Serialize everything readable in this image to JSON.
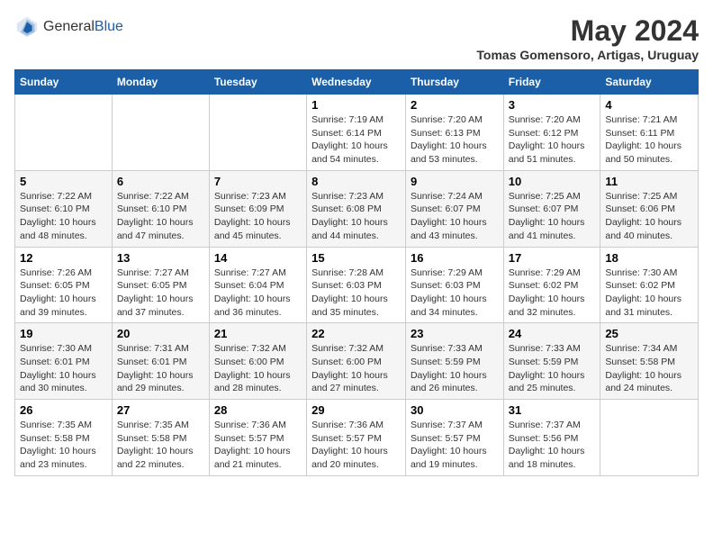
{
  "header": {
    "logo_general": "General",
    "logo_blue": "Blue",
    "month_year": "May 2024",
    "location": "Tomas Gomensoro, Artigas, Uruguay"
  },
  "weekdays": [
    "Sunday",
    "Monday",
    "Tuesday",
    "Wednesday",
    "Thursday",
    "Friday",
    "Saturday"
  ],
  "weeks": [
    [
      {
        "day": "",
        "info": ""
      },
      {
        "day": "",
        "info": ""
      },
      {
        "day": "",
        "info": ""
      },
      {
        "day": "1",
        "info": "Sunrise: 7:19 AM\nSunset: 6:14 PM\nDaylight: 10 hours\nand 54 minutes."
      },
      {
        "day": "2",
        "info": "Sunrise: 7:20 AM\nSunset: 6:13 PM\nDaylight: 10 hours\nand 53 minutes."
      },
      {
        "day": "3",
        "info": "Sunrise: 7:20 AM\nSunset: 6:12 PM\nDaylight: 10 hours\nand 51 minutes."
      },
      {
        "day": "4",
        "info": "Sunrise: 7:21 AM\nSunset: 6:11 PM\nDaylight: 10 hours\nand 50 minutes."
      }
    ],
    [
      {
        "day": "5",
        "info": "Sunrise: 7:22 AM\nSunset: 6:10 PM\nDaylight: 10 hours\nand 48 minutes."
      },
      {
        "day": "6",
        "info": "Sunrise: 7:22 AM\nSunset: 6:10 PM\nDaylight: 10 hours\nand 47 minutes."
      },
      {
        "day": "7",
        "info": "Sunrise: 7:23 AM\nSunset: 6:09 PM\nDaylight: 10 hours\nand 45 minutes."
      },
      {
        "day": "8",
        "info": "Sunrise: 7:23 AM\nSunset: 6:08 PM\nDaylight: 10 hours\nand 44 minutes."
      },
      {
        "day": "9",
        "info": "Sunrise: 7:24 AM\nSunset: 6:07 PM\nDaylight: 10 hours\nand 43 minutes."
      },
      {
        "day": "10",
        "info": "Sunrise: 7:25 AM\nSunset: 6:07 PM\nDaylight: 10 hours\nand 41 minutes."
      },
      {
        "day": "11",
        "info": "Sunrise: 7:25 AM\nSunset: 6:06 PM\nDaylight: 10 hours\nand 40 minutes."
      }
    ],
    [
      {
        "day": "12",
        "info": "Sunrise: 7:26 AM\nSunset: 6:05 PM\nDaylight: 10 hours\nand 39 minutes."
      },
      {
        "day": "13",
        "info": "Sunrise: 7:27 AM\nSunset: 6:05 PM\nDaylight: 10 hours\nand 37 minutes."
      },
      {
        "day": "14",
        "info": "Sunrise: 7:27 AM\nSunset: 6:04 PM\nDaylight: 10 hours\nand 36 minutes."
      },
      {
        "day": "15",
        "info": "Sunrise: 7:28 AM\nSunset: 6:03 PM\nDaylight: 10 hours\nand 35 minutes."
      },
      {
        "day": "16",
        "info": "Sunrise: 7:29 AM\nSunset: 6:03 PM\nDaylight: 10 hours\nand 34 minutes."
      },
      {
        "day": "17",
        "info": "Sunrise: 7:29 AM\nSunset: 6:02 PM\nDaylight: 10 hours\nand 32 minutes."
      },
      {
        "day": "18",
        "info": "Sunrise: 7:30 AM\nSunset: 6:02 PM\nDaylight: 10 hours\nand 31 minutes."
      }
    ],
    [
      {
        "day": "19",
        "info": "Sunrise: 7:30 AM\nSunset: 6:01 PM\nDaylight: 10 hours\nand 30 minutes."
      },
      {
        "day": "20",
        "info": "Sunrise: 7:31 AM\nSunset: 6:01 PM\nDaylight: 10 hours\nand 29 minutes."
      },
      {
        "day": "21",
        "info": "Sunrise: 7:32 AM\nSunset: 6:00 PM\nDaylight: 10 hours\nand 28 minutes."
      },
      {
        "day": "22",
        "info": "Sunrise: 7:32 AM\nSunset: 6:00 PM\nDaylight: 10 hours\nand 27 minutes."
      },
      {
        "day": "23",
        "info": "Sunrise: 7:33 AM\nSunset: 5:59 PM\nDaylight: 10 hours\nand 26 minutes."
      },
      {
        "day": "24",
        "info": "Sunrise: 7:33 AM\nSunset: 5:59 PM\nDaylight: 10 hours\nand 25 minutes."
      },
      {
        "day": "25",
        "info": "Sunrise: 7:34 AM\nSunset: 5:58 PM\nDaylight: 10 hours\nand 24 minutes."
      }
    ],
    [
      {
        "day": "26",
        "info": "Sunrise: 7:35 AM\nSunset: 5:58 PM\nDaylight: 10 hours\nand 23 minutes."
      },
      {
        "day": "27",
        "info": "Sunrise: 7:35 AM\nSunset: 5:58 PM\nDaylight: 10 hours\nand 22 minutes."
      },
      {
        "day": "28",
        "info": "Sunrise: 7:36 AM\nSunset: 5:57 PM\nDaylight: 10 hours\nand 21 minutes."
      },
      {
        "day": "29",
        "info": "Sunrise: 7:36 AM\nSunset: 5:57 PM\nDaylight: 10 hours\nand 20 minutes."
      },
      {
        "day": "30",
        "info": "Sunrise: 7:37 AM\nSunset: 5:57 PM\nDaylight: 10 hours\nand 19 minutes."
      },
      {
        "day": "31",
        "info": "Sunrise: 7:37 AM\nSunset: 5:56 PM\nDaylight: 10 hours\nand 18 minutes."
      },
      {
        "day": "",
        "info": ""
      }
    ]
  ]
}
